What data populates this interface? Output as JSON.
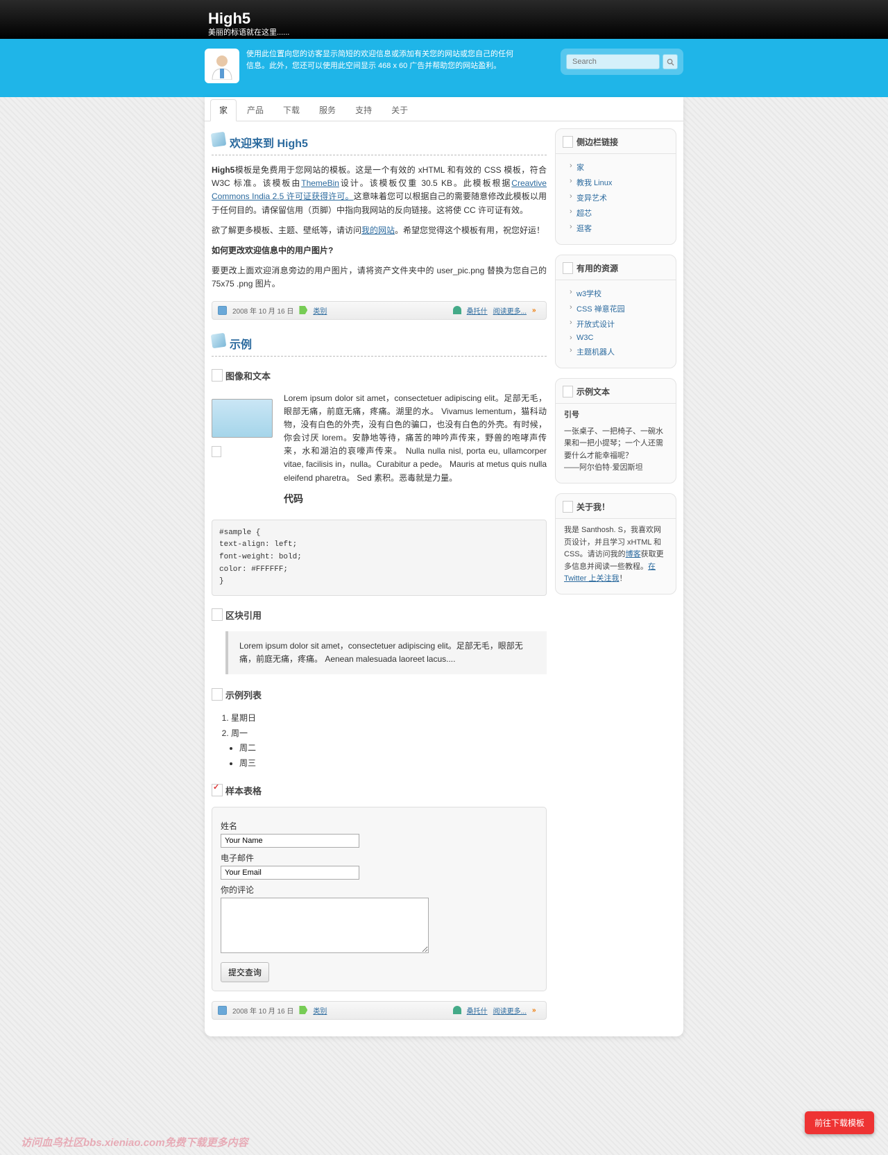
{
  "site": {
    "title": "High5",
    "tagline": "美丽的标语就在这里......"
  },
  "welcome_banner": "使用此位置向您的访客显示简短的欢迎信息或添加有关您的网站或您自己的任何信息。此外，您还可以使用此空间显示 468 x 60 广告并帮助您的网站盈利。",
  "search": {
    "placeholder": "Search"
  },
  "nav": [
    "家",
    "产品",
    "下载",
    "服务",
    "支持",
    "关于"
  ],
  "post1": {
    "title": "欢迎来到 High5",
    "p1_a": "High5",
    "p1_b": "模板是免费用于您网站的模板。这是一个有效的 xHTML 和有效的 CSS 模板，符合 W3C 标准。该模板由",
    "link1": "ThemeBin",
    "p1_c": "设计。该模板仅重 30.5 KB。此模板根据",
    "link2": "Creavtive Commons India 2.5 许可证获得许可。",
    "p1_d": "这意味着您可以根据自己的需要随意修改此模板以用于任何目的。请保留信用（页脚）中指向我网站的反向链接。这将使 CC 许可证有效。",
    "p2_a": "欲了解更多模板、主题、壁纸等，请访问",
    "link3": "我的网站",
    "p2_b": "。希望您觉得这个模板有用，祝您好运！",
    "p3": "如何更改欢迎信息中的用户图片?",
    "p4": "要更改上面欢迎消息旁边的用户图片，请将资产文件夹中的 user_pic.png 替换为您自己的 75x75 .png 图片。"
  },
  "meta": {
    "date": "2008 年 10 月 16 日",
    "category": "类别",
    "author": "桑托什",
    "more": "阅读更多..."
  },
  "post2": {
    "title": "示例",
    "h_imgtxt": "图像和文本",
    "lorem": "Lorem ipsum dolor sit amet，consectetuer adipiscing elit。足部无毛，眼部无痛，前庭无痛，疼痛。湖里的水。 Vivamus lementum，猫科动物，没有白色的外壳，没有白色的骗口，也没有白色的外壳。有时候，你会讨厌 lorem。安静地等待，痛苦的呻吟声传来，野兽的咆哮声传来，水和湖泊的哀嚎声传来。 Nulla nulla nisl, porta eu, ullamcorper vitae, facilisis in，nulla。Curabitur a pede。 Mauris at metus quis nulla eleifend pharetra。 Sed 素积。恶毒就是力量。",
    "h_code": "代码",
    "code": "#sample {\ntext-align: left;\nfont-weight: bold;\ncolor: #FFFFFF;\n}",
    "h_block": "区块引用",
    "block": "Lorem ipsum dolor sit amet，consectetuer adipiscing elit。足部无毛，眼部无痛，前庭无痛，疼痛。 Aenean malesuada laoreet lacus....",
    "h_list": "示例列表",
    "ol": [
      "星期日",
      "周一"
    ],
    "ul": [
      "周二",
      "周三"
    ],
    "h_form": "样本表格",
    "f_name": "姓名",
    "f_name_ph": "Your Name",
    "f_email": "电子邮件",
    "f_email_ph": "Your Email",
    "f_comment": "你的评论",
    "f_submit": "提交查询"
  },
  "sidebar": {
    "links_title": "侧边栏链接",
    "links": [
      "家",
      "教我 Linux",
      "变异艺术",
      "超芯",
      "逛客"
    ],
    "res_title": "有用的资源",
    "res": [
      "w3学校",
      "CSS 禅意花园",
      "开放式设计",
      "W3C",
      "主题机器人"
    ],
    "sample_title": "示例文本",
    "quote_h": "引号",
    "quote": "一张桌子、一把椅子、一碗水果和一把小提琴；一个人还需要什么才能幸福呢？",
    "quote_by": "——阿尔伯特·爱因斯坦",
    "about_title": "关于我！",
    "about_a": "我是 Santhosh. S，我喜欢网页设计，并且学习 xHTML 和 CSS。请访问我的",
    "about_link1": "博客",
    "about_b": "获取更多信息并阅读一些教程。",
    "about_link2": "在 Twitter 上关注我",
    "about_c": "！"
  },
  "download_btn": "前往下载模板",
  "watermark": "访问血鸟社区bbs.xieniao.com免费下载更多内容"
}
